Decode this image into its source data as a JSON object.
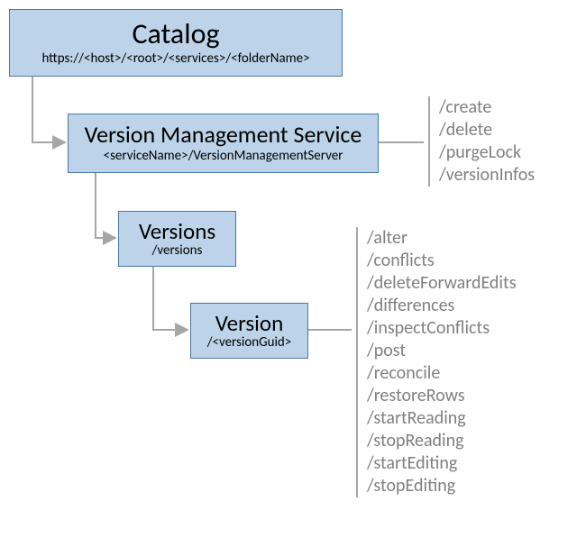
{
  "nodes": {
    "catalog": {
      "title": "Catalog",
      "subtitle": "https://<host>/<root>/<services>/<folderName>"
    },
    "vms": {
      "title": "Version Management Service",
      "subtitle": "<serviceName>/VersionManagementServer"
    },
    "versions": {
      "title": "Versions",
      "subtitle": "/versions"
    },
    "version": {
      "title": "Version",
      "subtitle": "/<versionGuid>"
    }
  },
  "endpoints": {
    "vms": [
      "/create",
      "/delete",
      "/purgeLock",
      "/versionInfos"
    ],
    "version": [
      "/alter",
      "/conflicts",
      "/deleteForwardEdits",
      "/differences",
      "/inspectConflicts",
      "/post",
      "/reconcile",
      "/restoreRows",
      "/startReading",
      "/stopReading",
      "/startEditing",
      "/stopEditing"
    ]
  },
  "colors": {
    "nodeFill": "#bcd3e9",
    "nodeBorder": "#4a78a4",
    "connector": "#a6a6a6",
    "endpointText": "#808080"
  }
}
